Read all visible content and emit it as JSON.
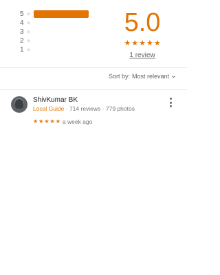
{
  "histogram": [
    {
      "label": "5",
      "fraction": 1.0
    },
    {
      "label": "4",
      "fraction": 0
    },
    {
      "label": "3",
      "fraction": 0
    },
    {
      "label": "2",
      "fraction": 0
    },
    {
      "label": "1",
      "fraction": 0
    }
  ],
  "summary": {
    "score": "5.0",
    "stars": 5,
    "review_count_label": "1 review"
  },
  "sort": {
    "label": "Sort by:",
    "value": "Most relevant"
  },
  "review": {
    "author": "ShivKumar BK",
    "badge": "Local Guide",
    "reviews": "· 714 reviews",
    "photos": "· 779 photos",
    "stars": 5,
    "time": "a week ago"
  },
  "colors": {
    "accent": "#e37400",
    "empty_star": "#dadce0",
    "muted_text": "#5f6368"
  },
  "icons": {
    "star": "star-icon",
    "chevron": "chevron-down-icon",
    "more": "more-vert-icon"
  }
}
